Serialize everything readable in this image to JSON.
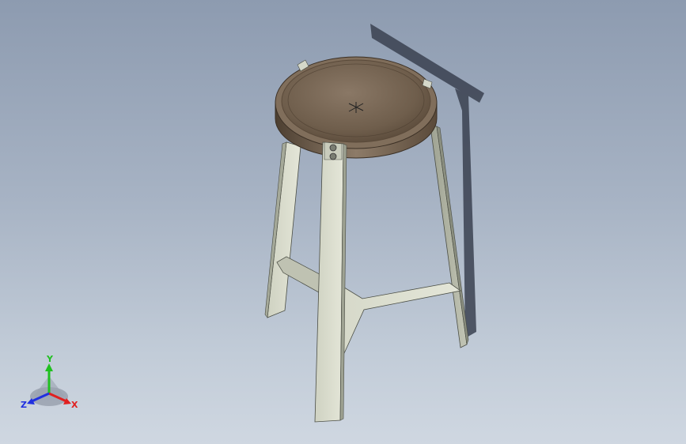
{
  "viewport": {
    "background_top": "#8d9bb0",
    "background_bottom": "#cfd7e1"
  },
  "model": {
    "origin_marker_icon": "origin-x-icon",
    "seat_color": "#7b6a57",
    "frame_color": "#d5d8c9",
    "shadow_color": "#2f3642"
  },
  "triad": {
    "x_label": "X",
    "y_label": "Y",
    "z_label": "Z",
    "x_color": "#e02020",
    "y_color": "#20c020",
    "z_color": "#2030e0"
  }
}
